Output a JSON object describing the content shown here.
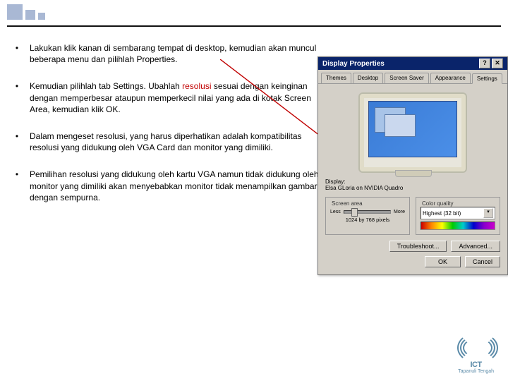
{
  "bullets": [
    "Lakukan klik kanan di sembarang tempat di desktop, kemudian akan muncul beberapa menu dan  pilihlah Properties.",
    "Kemudian pilihlah  tab Settings. Ubahlah {resolusi} sesuai dengan keinginan dengan memperbesar ataupun memperkecil nilai yang ada di kotak Screen Area, kemudian klik OK.",
    "Dalam mengeset resolusi, yang harus diperhatikan adalah kompatibilitas resolusi yang didukung oleh VGA Card dan monitor yang dimiliki.",
    "Pemilihan resolusi yang didukung oleh kartu VGA namun tidak didukung oleh monitor yang dimiliki akan menyebabkan monitor tidak menampilkan gambar dengan sempurna."
  ],
  "resolusi_word": "resolusi",
  "dialog": {
    "title": "Display Properties",
    "help": "?",
    "close": "✕",
    "tabs": [
      "Themes",
      "Desktop",
      "Screen Saver",
      "Appearance",
      "Settings"
    ],
    "display_label": "Display:",
    "display_value": "Elsa GLoria on NVIDIA Quadro",
    "screen_area": {
      "label": "Screen area",
      "less": "Less",
      "more": "More",
      "value": "1024 by 768 pixels"
    },
    "color": {
      "label": "Color quality",
      "value": "Highest (32 bit)"
    },
    "buttons": {
      "troubleshoot": "Troubleshoot...",
      "advanced": "Advanced...",
      "ok": "OK",
      "cancel": "Cancel"
    }
  },
  "logo": {
    "text": "ICT",
    "sub": "Tapanuli Tengah"
  }
}
